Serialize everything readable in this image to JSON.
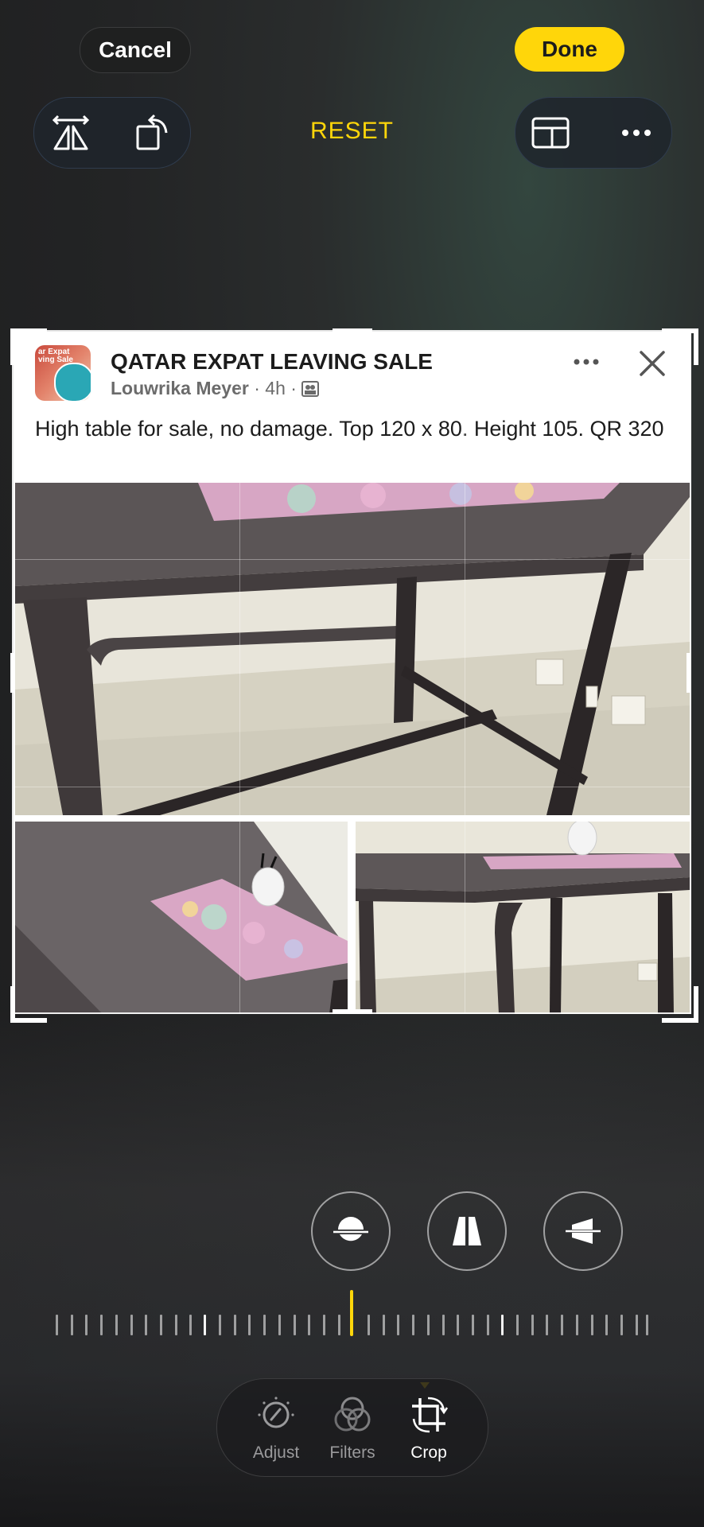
{
  "topbar": {
    "cancel_label": "Cancel",
    "done_label": "Done",
    "reset_label": "RESET"
  },
  "post": {
    "group_name": "QATAR EXPAT LEAVING SALE",
    "avatar_text": "ar Expat\nving Sale",
    "author": "Louwrika Meyer",
    "time": "4h",
    "separator": "·",
    "body": "High table for sale,  no damage. Top 120 x 80. Height 105. QR 320"
  },
  "tabs": [
    {
      "label": "Adjust",
      "icon": "adjust-dial-icon",
      "active": false
    },
    {
      "label": "Filters",
      "icon": "filters-circles-icon",
      "active": false
    },
    {
      "label": "Crop",
      "icon": "crop-rotate-icon",
      "active": true
    }
  ],
  "straighten_tools": [
    "straighten-horizon-icon",
    "vertical-perspective-icon",
    "horizontal-perspective-icon"
  ],
  "colors": {
    "accent": "#ffd60a",
    "background": "#232425"
  }
}
